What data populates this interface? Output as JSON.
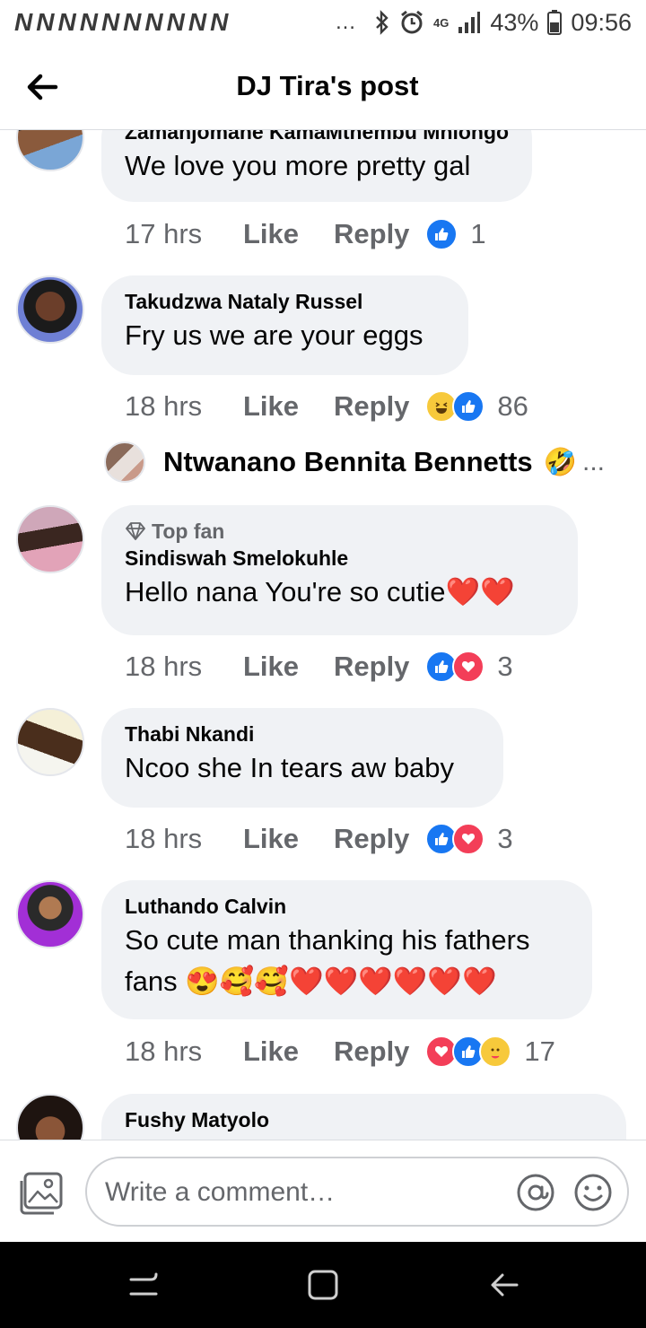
{
  "status_bar": {
    "notification_icons": [
      "N",
      "N",
      "N",
      "N",
      "N",
      "N",
      "N",
      "N",
      "N",
      "N"
    ],
    "more_indicator": "…",
    "network": "4G",
    "battery": "43%",
    "time": "09:56"
  },
  "header": {
    "title": "DJ Tira's post"
  },
  "comments": [
    {
      "name": "Zamanjomane KamaMthembu Mhlongo",
      "text": "We love you more pretty gal",
      "time": "17 hrs",
      "like": "Like",
      "reply": "Reply",
      "reactions": [
        "like"
      ],
      "count": "1"
    },
    {
      "name": "Takudzwa Nataly Russel",
      "text": "Fry us we are your eggs",
      "time": "18 hrs",
      "like": "Like",
      "reply": "Reply",
      "reactions": [
        "haha",
        "like"
      ],
      "count": "86"
    },
    {
      "badge": "Top fan",
      "name": "Sindiswah Smelokuhle",
      "text": "Hello nana You're so cutie❤️❤️",
      "time": "18 hrs",
      "like": "Like",
      "reply": "Reply",
      "reactions": [
        "like",
        "love"
      ],
      "count": "3"
    },
    {
      "name": "Thabi Nkandi",
      "text": "Ncoo she In tears aw baby",
      "time": "18 hrs",
      "like": "Like",
      "reply": "Reply",
      "reactions": [
        "like",
        "love"
      ],
      "count": "3"
    },
    {
      "name": "Luthando Calvin",
      "text_line1": "So cute man thanking his fathers",
      "text_line2": "fans 😍🥰🥰❤️❤️❤️❤️❤️❤️",
      "time": "18 hrs",
      "like": "Like",
      "reply": "Reply",
      "reactions": [
        "love",
        "like",
        "care"
      ],
      "count": "17"
    },
    {
      "name": "Fushy Matyolo"
    }
  ],
  "reply_preview": {
    "name": "Ntwanano Bennita Bennetts",
    "emoji": "🤣",
    "more": "..."
  },
  "composer": {
    "placeholder": "Write a comment…"
  },
  "colors": {
    "like_blue": "#1877f2",
    "love_red": "#f33e58",
    "bubble_gray": "#f0f2f5",
    "secondary_text": "#65676b"
  }
}
